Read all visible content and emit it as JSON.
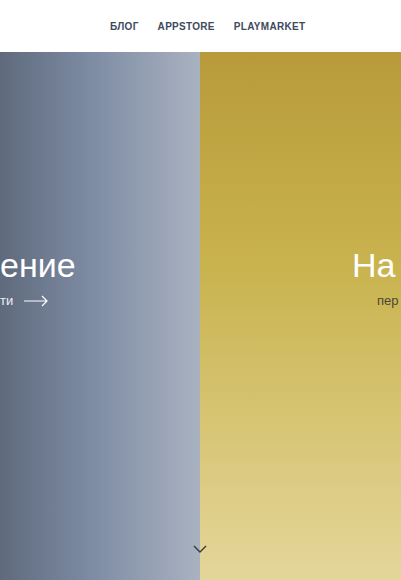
{
  "nav": {
    "items": [
      "БЛОГ",
      "APPSTORE",
      "PLAYMARKET"
    ]
  },
  "panels": [
    {
      "title": "ение",
      "link": "ти",
      "color": "#7d8ba3"
    },
    {
      "title": "На",
      "link": "пер",
      "color": "#c9b34e"
    }
  ]
}
